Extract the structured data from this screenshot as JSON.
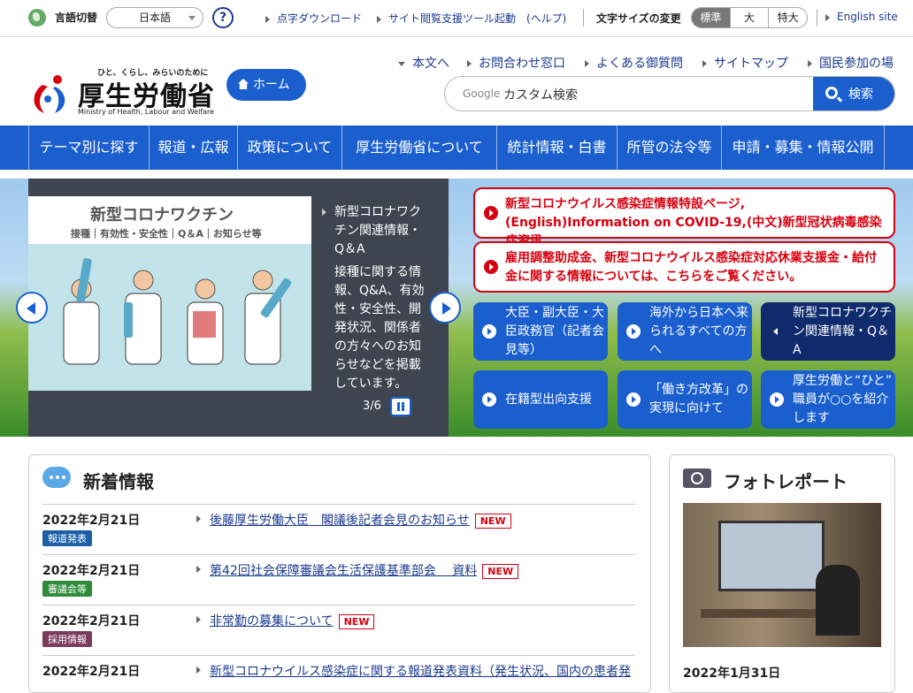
{
  "topbar": {
    "lang_label": "言語切替",
    "lang_select": "日本語",
    "help": "?",
    "braille": "点字ダウンロード",
    "assist": "サイト閲覧支援ツール起動　(ヘルプ)",
    "fontsize_label": "文字サイズの変更",
    "fontsize_options": [
      "標準",
      "大",
      "特大"
    ],
    "english": "English site"
  },
  "header": {
    "logo_tagline": "ひと、くらし、みらいのために",
    "logo_name": "厚生労働省",
    "logo_en": "Ministry of Health, Labour and Welfare",
    "home": "ホーム",
    "utility": [
      "本文へ",
      "お問合わせ窓口",
      "よくある御質問",
      "サイトマップ",
      "国民参加の場"
    ],
    "search_brand": "Google",
    "search_placeholder": "カスタム検索",
    "search_button": "検索"
  },
  "gnav": [
    "テーマ別に探す",
    "報道・広報",
    "政策について",
    "厚生労働省について",
    "統計情報・白書",
    "所管の法令等",
    "申請・募集・情報公開"
  ],
  "hero": {
    "slide_title": "新型コロナワクチン",
    "slide_subtitle": "接種｜有効性・安全性｜Q＆A｜お知らせ等",
    "slide_heading": "新型コロナワクチン関連情報・Q＆A",
    "slide_body": "接種に関する情報、Q&A、有効性・安全性、開発状況、関係者の方々へのお知らせなどを掲載しています。",
    "slide_counter": "3/6",
    "red_links": [
      "新型コロナウイルス感染症情報特設ページ,(English)Information on COVID-19,(中文)新型冠状病毒感染症资讯",
      "雇用調整助成金、新型コロナウイルス感染症対応休業支援金・給付金に関する情報については、こちらをご覧ください。"
    ],
    "tiles": [
      "大臣・副大臣・大臣政務官（記者会見等）",
      "海外から日本へ来られるすべての方へ",
      "新型コロナワクチン関連情報・Q＆A",
      "在籍型出向支援",
      "「働き方改革」の実現に向けて",
      "厚生労働と“ひと”　職員が○○を紹介します"
    ]
  },
  "news": {
    "title": "新着情報",
    "new_label": "NEW",
    "items": [
      {
        "date": "2022年2月21日",
        "tag": "報道発表",
        "tag_color": "#1b5fa8",
        "title": "後藤厚生労働大臣　閣議後記者会見のお知らせ"
      },
      {
        "date": "2022年2月21日",
        "tag": "審議会等",
        "tag_color": "#2e8b3a",
        "title": "第42回社会保障審議会生活保護基準部会　 資料"
      },
      {
        "date": "2022年2月21日",
        "tag": "採用情報",
        "tag_color": "#7a3a5c",
        "title": "非常勤の募集について"
      },
      {
        "date": "2022年2月21日",
        "tag": "",
        "tag_color": "",
        "title": "新型コロナウイルス感染症に関する報道発表資料（発生状況、国内の患者発"
      }
    ]
  },
  "photo": {
    "title": "フォトレポート",
    "date": "2022年1月31日"
  }
}
